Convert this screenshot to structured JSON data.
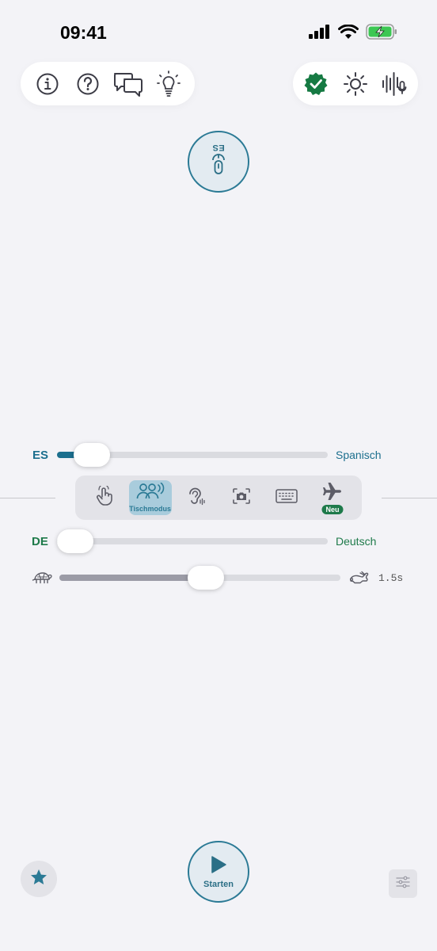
{
  "status_bar": {
    "time": "09:41",
    "icons": [
      "cellular-signal-icon",
      "wifi-icon",
      "battery-charging-icon"
    ]
  },
  "toolbar_left": {
    "icons": [
      "info-icon",
      "help-icon",
      "chat-bubbles-icon",
      "lightbulb-icon"
    ]
  },
  "toolbar_right": {
    "icons": [
      "verified-check-icon",
      "brightness-icon",
      "voice-waveform-icon"
    ]
  },
  "mic_button": {
    "code": "ES",
    "icon": "microphone-icon"
  },
  "source_language": {
    "code": "ES",
    "name": "Spanisch",
    "color": "#1c6f8e",
    "slider_value": 0.13
  },
  "target_language": {
    "code": "DE",
    "name": "Deutsch",
    "color": "#1e7a4a",
    "slider_value": 0.05
  },
  "modes": [
    {
      "name": "tap",
      "icon": "tap-hand-icon",
      "label": "",
      "active": false
    },
    {
      "name": "table",
      "icon": "people-speaking-icon",
      "label": "Tischmodus",
      "active": true
    },
    {
      "name": "listen",
      "icon": "hearing-icon",
      "label": "",
      "active": false
    },
    {
      "name": "camera",
      "icon": "camera-icon",
      "label": "",
      "active": false
    },
    {
      "name": "keyboard",
      "icon": "keyboard-icon",
      "label": "",
      "active": false
    },
    {
      "name": "offline",
      "icon": "airplane-icon",
      "label": "",
      "badge": "Neu",
      "active": false
    }
  ],
  "speed": {
    "slow_icon": "turtle-icon",
    "fast_icon": "hare-icon",
    "value_label": "1.5s",
    "slider_value": 0.52
  },
  "start_button": {
    "label": "Starten",
    "icon": "play-icon"
  },
  "bottom": {
    "favorite_icon": "star-icon",
    "settings_icon": "sliders-icon"
  },
  "colors": {
    "accent": "#2b7a95",
    "background": "#f3f3f7",
    "verified_green": "#167a43"
  }
}
